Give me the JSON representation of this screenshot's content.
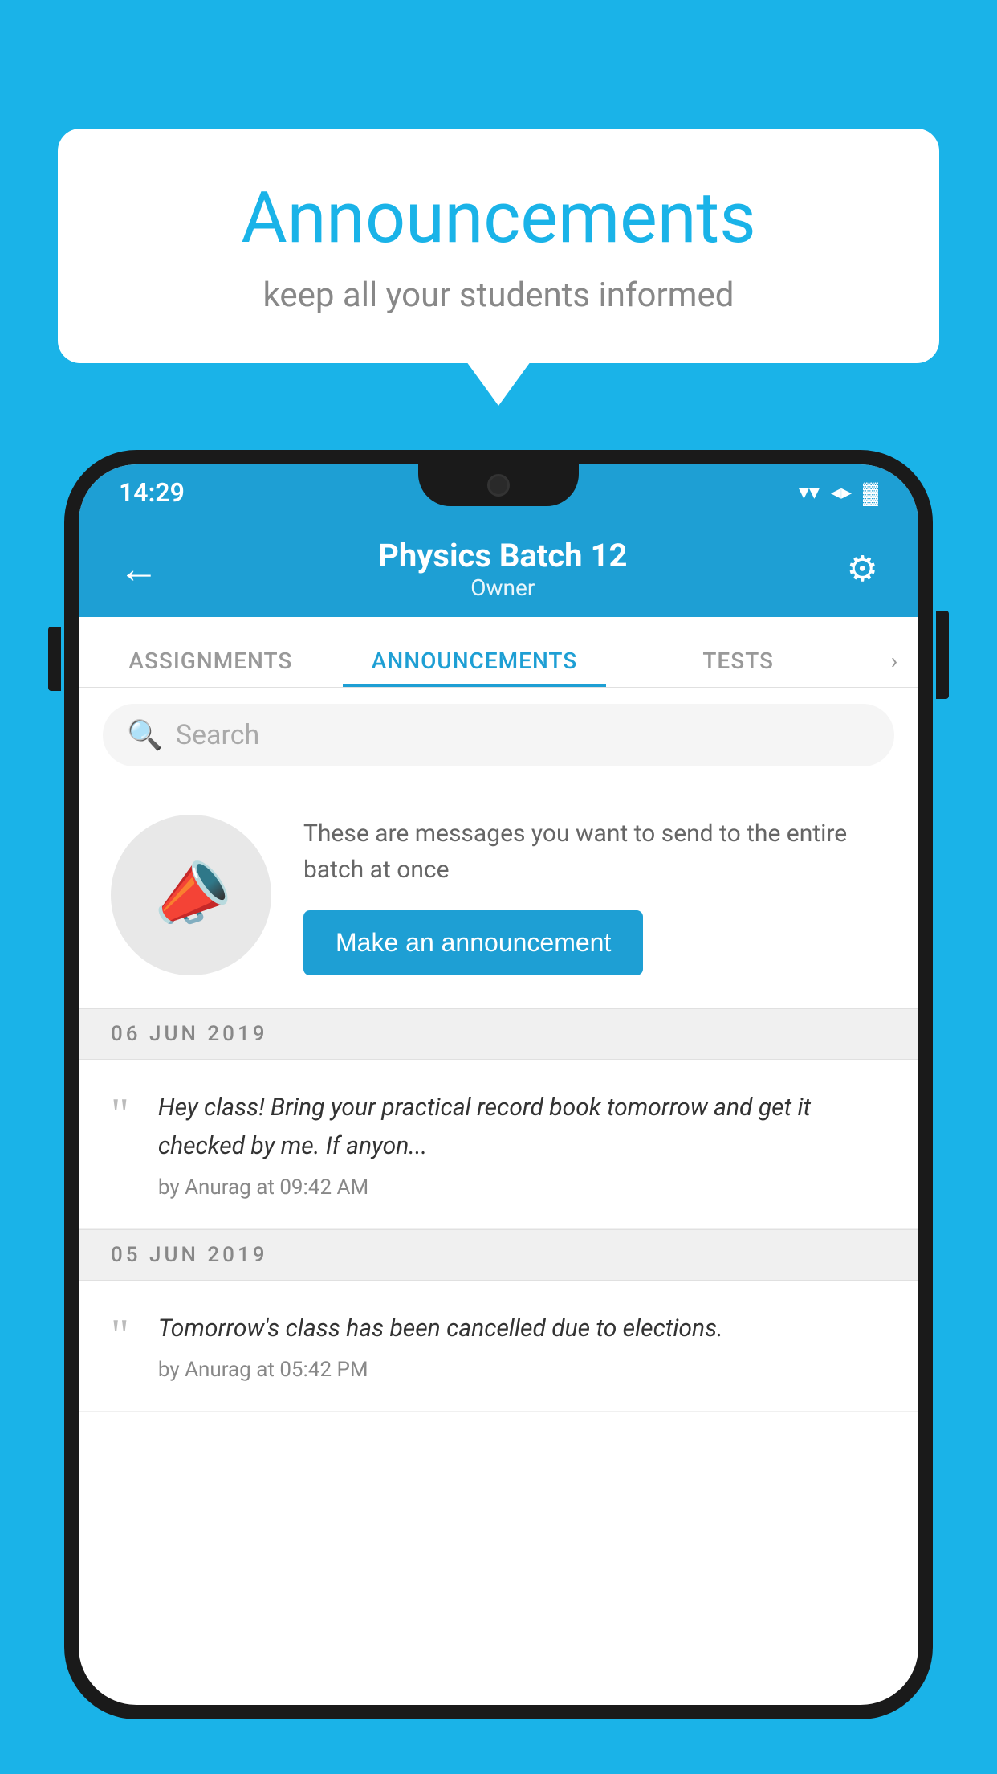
{
  "background_color": "#1ab3e8",
  "speech_bubble": {
    "title": "Announcements",
    "subtitle": "keep all your students informed"
  },
  "status_bar": {
    "time": "14:29",
    "wifi_icon": "▲",
    "signal_icon": "▲",
    "battery_icon": "▊"
  },
  "header": {
    "back_label": "←",
    "title": "Physics Batch 12",
    "subtitle": "Owner",
    "settings_icon": "⚙"
  },
  "tabs": [
    {
      "label": "ASSIGNMENTS",
      "active": false
    },
    {
      "label": "ANNOUNCEMENTS",
      "active": true
    },
    {
      "label": "TESTS",
      "active": false
    }
  ],
  "tabs_more": "›",
  "search": {
    "placeholder": "Search"
  },
  "promo": {
    "description": "These are messages you want to send to the entire batch at once",
    "button_label": "Make an announcement"
  },
  "announcements": [
    {
      "date": "06  JUN  2019",
      "message": "Hey class! Bring your practical record book tomorrow and get it checked by me. If anyon...",
      "author": "by Anurag at 09:42 AM"
    },
    {
      "date": "05  JUN  2019",
      "message": "Tomorrow's class has been cancelled due to elections.",
      "author": "by Anurag at 05:42 PM"
    }
  ]
}
